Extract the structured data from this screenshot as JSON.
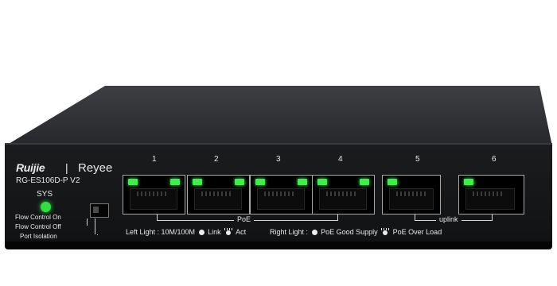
{
  "brand": {
    "ruijie": "Ruijie",
    "separator": "|",
    "reyee": "Reyee"
  },
  "model": "RG-ES106D-P V2",
  "sys_label": "SYS",
  "switch_labels": {
    "flow_on": "Flow Control On",
    "flow_off": "Flow Control Off",
    "isolation": "Port Isolation"
  },
  "ports": [
    {
      "number": "1",
      "left_led": "on",
      "right_led": "on"
    },
    {
      "number": "2",
      "left_led": "on",
      "right_led": "on"
    },
    {
      "number": "3",
      "left_led": "on",
      "right_led": "on"
    },
    {
      "number": "4",
      "left_led": "on",
      "right_led": "on"
    },
    {
      "number": "5",
      "left_led": "on"
    },
    {
      "number": "6",
      "left_led": "on"
    }
  ],
  "groups": {
    "poe": "PoE",
    "uplink": "uplink"
  },
  "legend": {
    "left_prefix": "Left Light : 10M/100M",
    "link": "Link",
    "act": "Act",
    "right_prefix": "Right Light :",
    "poe_good": "PoE Good Supply",
    "poe_over": "PoE Over Load"
  },
  "icons": {
    "link": "solid-dot-icon",
    "act": "blinking-light-icon"
  },
  "colors": {
    "led_green": "#3cf04b",
    "chassis": "#141517",
    "silkscreen": "#e8e8e8"
  }
}
